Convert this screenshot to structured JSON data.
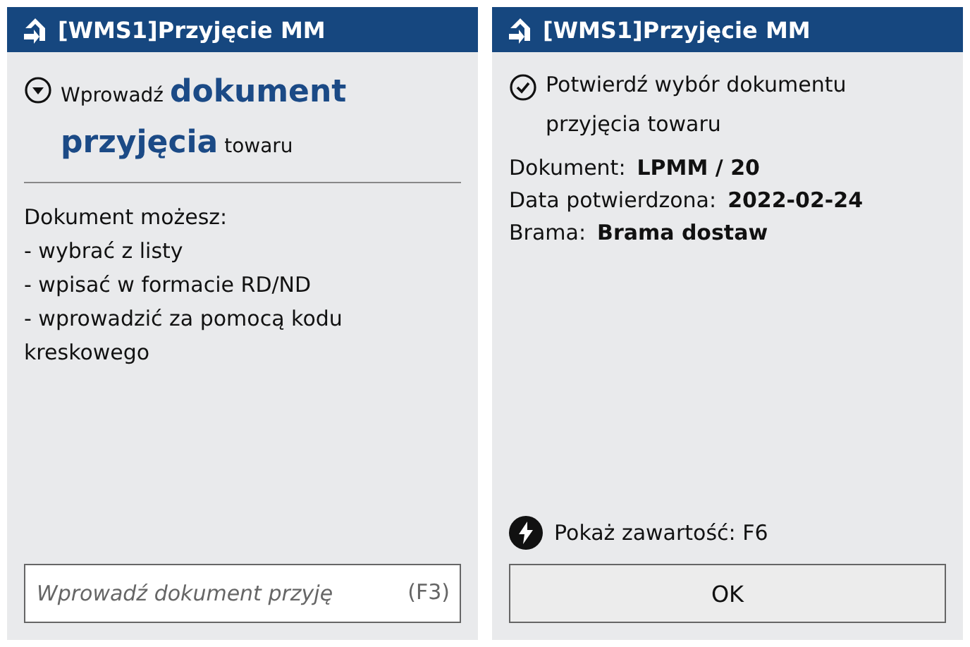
{
  "panels": [
    {
      "title": "[WMS1]Przyjęcie MM",
      "heading": "Wprowadź **dokument przyjęcia** towaru",
      "kind": "input",
      "lines": [
        "Dokument możesz:",
        "- wybrać z listy",
        "- wpisać w formacie RD/ND",
        "- wprowadzić za pomocą kodu kreskowego"
      ],
      "input": {
        "placeholder": "Wprowadź dokument przyję",
        "shortcut": "(F3)"
      }
    },
    {
      "title": "[WMS1]Przyjęcie MM",
      "heading": "Potwierdź wybór dokumentu przyjęcia towaru",
      "kind": "confirm",
      "fields": [
        {
          "label": "Dokument:",
          "value": "LPMM / 20"
        },
        {
          "label": "Data potwierdzona:",
          "value": "2022-02-24"
        },
        {
          "label": "Brama:",
          "value": "Brama dostaw"
        }
      ],
      "hint": "Pokaż zawartość: F6",
      "button": "OK"
    }
  ]
}
